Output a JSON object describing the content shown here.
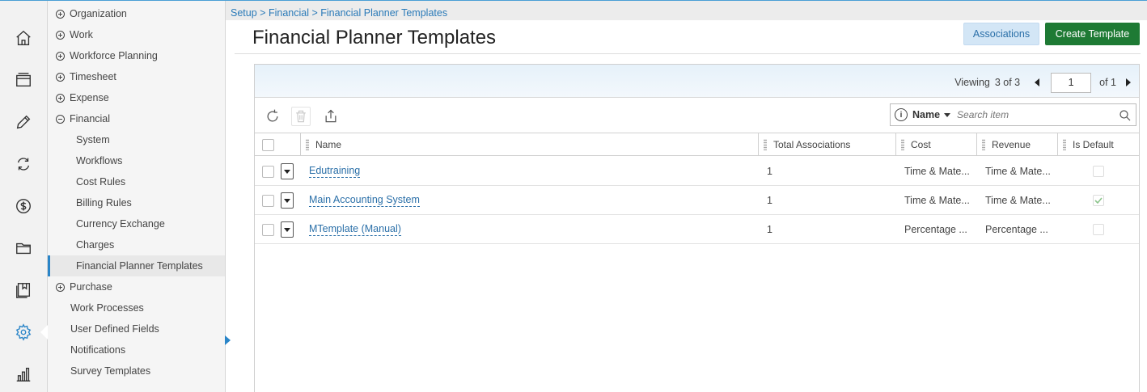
{
  "rail": {
    "icons": [
      "home-icon",
      "layers-icon",
      "pencil-icon",
      "sync-icon",
      "dollar-icon",
      "folder-icon",
      "bookmark-icon",
      "gear-icon",
      "bar-chart-icon"
    ],
    "active": "gear-icon"
  },
  "tree": {
    "items": [
      {
        "label": "Organization",
        "kind": "plus"
      },
      {
        "label": "Work",
        "kind": "plus"
      },
      {
        "label": "Workforce Planning",
        "kind": "plus"
      },
      {
        "label": "Timesheet",
        "kind": "plus"
      },
      {
        "label": "Expense",
        "kind": "plus"
      },
      {
        "label": "Financial",
        "kind": "minus"
      },
      {
        "label": "System",
        "kind": "child"
      },
      {
        "label": "Workflows",
        "kind": "child"
      },
      {
        "label": "Cost Rules",
        "kind": "child"
      },
      {
        "label": "Billing Rules",
        "kind": "child"
      },
      {
        "label": "Currency Exchange",
        "kind": "child"
      },
      {
        "label": "Charges",
        "kind": "child"
      },
      {
        "label": "Financial Planner Templates",
        "kind": "child-selected"
      },
      {
        "label": "Purchase",
        "kind": "plus"
      },
      {
        "label": "Work Processes",
        "kind": "leaf"
      },
      {
        "label": "User Defined Fields",
        "kind": "leaf"
      },
      {
        "label": "Notifications",
        "kind": "leaf"
      },
      {
        "label": "Survey Templates",
        "kind": "leaf"
      }
    ]
  },
  "breadcrumb": {
    "items": [
      "Setup",
      "Financial",
      "Financial Planner Templates"
    ],
    "separator": ">"
  },
  "page": {
    "title": "Financial Planner Templates",
    "associations_label": "Associations",
    "create_label": "Create Template"
  },
  "pager": {
    "viewing_label": "Viewing",
    "viewing_value": "3 of 3",
    "page_value": "1",
    "of_label": "of 1"
  },
  "search": {
    "field": "Name",
    "placeholder": "Search item"
  },
  "table": {
    "columns": [
      "Name",
      "Total Associations",
      "Cost",
      "Revenue",
      "Is Default"
    ],
    "rows": [
      {
        "name": "Edutraining",
        "total": "1",
        "cost": "Time & Mate...",
        "revenue": "Time & Mate...",
        "is_default": false
      },
      {
        "name": "Main Accounting System",
        "total": "1",
        "cost": "Time & Mate...",
        "revenue": "Time & Mate...",
        "is_default": true
      },
      {
        "name": "MTemplate (Manual)",
        "total": "1",
        "cost": "Percentage ...",
        "revenue": "Percentage ...",
        "is_default": false
      }
    ]
  },
  "colors": {
    "accent": "#2a85c8",
    "create_button": "#1e7a34",
    "associations_button": "#d3e6f6",
    "link": "#2a6fa8"
  }
}
